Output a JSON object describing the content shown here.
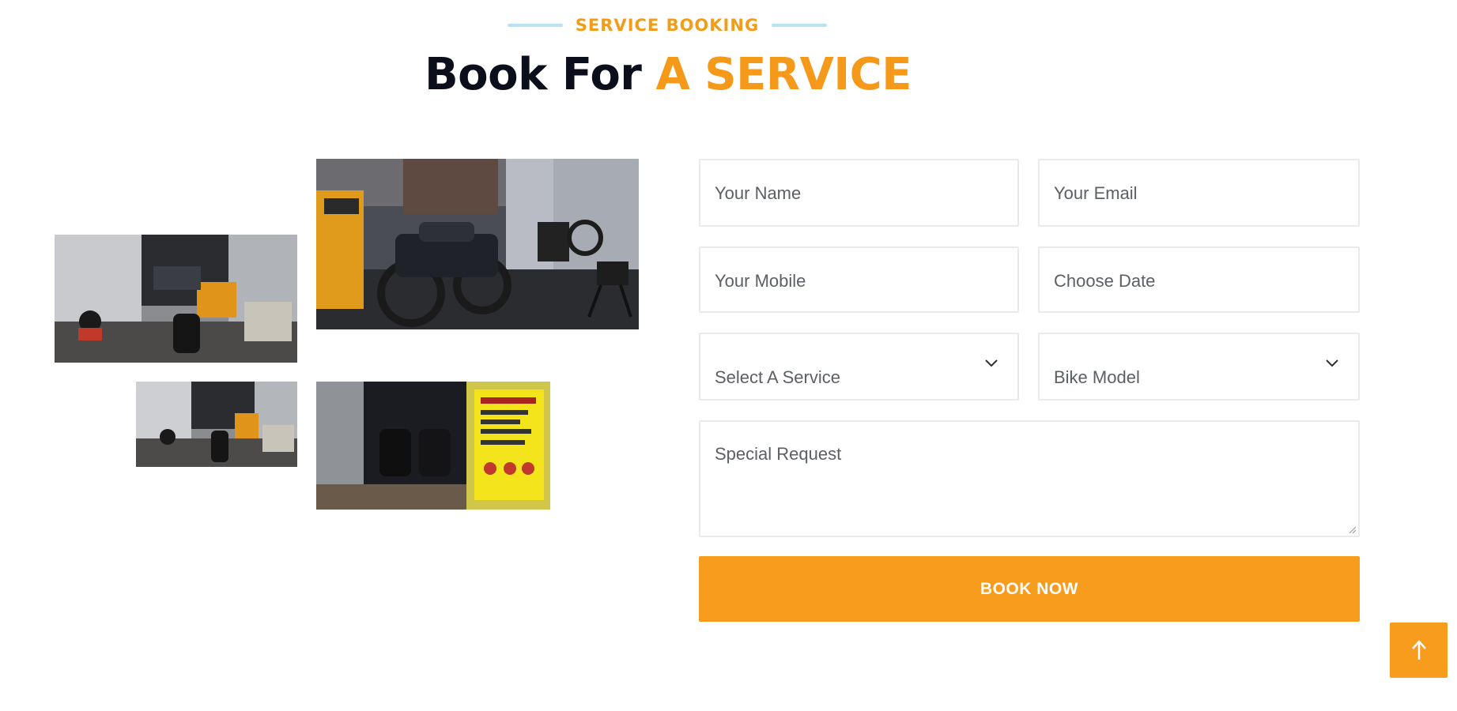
{
  "header": {
    "eyebrow": "SERVICE BOOKING",
    "title_plain": "Book For",
    "title_accent": "A SERVICE"
  },
  "colors": {
    "accent": "#f79c1c",
    "title_dark": "#0b0f1c",
    "eyebrow_line": "#b7e3f8",
    "field_border": "#e9eaed"
  },
  "gallery": {
    "images": [
      {
        "name": "workshop-motorcycle-photo"
      },
      {
        "name": "workshop-interior-photo"
      },
      {
        "name": "workshop-interior-small-photo"
      },
      {
        "name": "workshop-entrance-photo"
      }
    ]
  },
  "form": {
    "name_placeholder": "Your Name",
    "email_placeholder": "Your Email",
    "mobile_placeholder": "Your Mobile",
    "date_placeholder": "Choose Date",
    "service_select": "Select A Service",
    "bike_select": "Bike Model",
    "request_placeholder": "Special Request",
    "submit_label": "BOOK NOW"
  },
  "icons": {
    "select_chevron": "chevron-down-icon",
    "back_to_top": "arrow-up-icon"
  }
}
